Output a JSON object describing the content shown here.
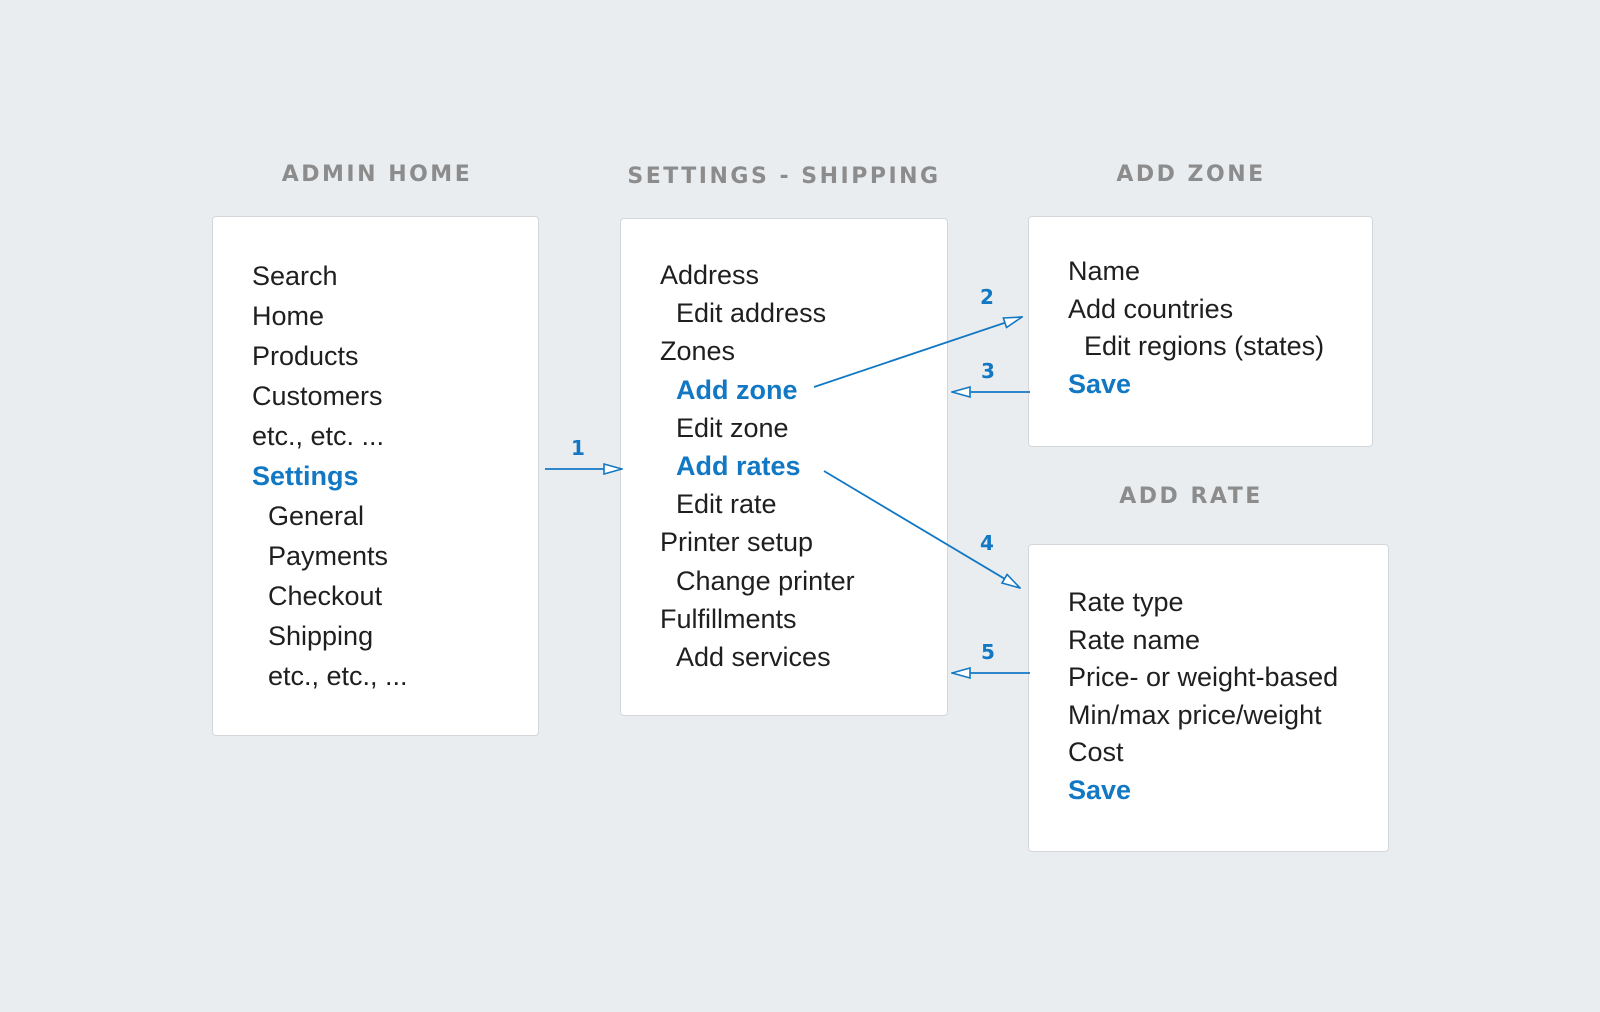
{
  "colors": {
    "background": "#eaedf0",
    "panel": "#ffffff",
    "title": "#8c8c8c",
    "text": "#1f1f1f",
    "accent": "#1278c4"
  },
  "panels": {
    "admin_home": {
      "title": "ADMIN HOME",
      "items": [
        {
          "label": "Search",
          "level": 0
        },
        {
          "label": "Home",
          "level": 0
        },
        {
          "label": "Products",
          "level": 0
        },
        {
          "label": "Customers",
          "level": 0
        },
        {
          "label": "etc., etc. ...",
          "level": 0
        },
        {
          "label": "Settings",
          "level": 0,
          "highlight": true
        },
        {
          "label": "General",
          "level": 1
        },
        {
          "label": "Payments",
          "level": 1
        },
        {
          "label": "Checkout",
          "level": 1
        },
        {
          "label": "Shipping",
          "level": 1
        },
        {
          "label": "etc., etc., ...",
          "level": 1
        }
      ]
    },
    "settings_shipping": {
      "title": "SETTINGS - SHIPPING",
      "items": [
        {
          "label": "Address",
          "level": 0
        },
        {
          "label": "Edit address",
          "level": 1
        },
        {
          "label": "Zones",
          "level": 0
        },
        {
          "label": "Add zone",
          "level": 1,
          "highlight": true
        },
        {
          "label": "Edit zone",
          "level": 1
        },
        {
          "label": "Add rates",
          "level": 1,
          "highlight": true
        },
        {
          "label": "Edit rate",
          "level": 1
        },
        {
          "label": "Printer setup",
          "level": 0
        },
        {
          "label": "Change printer",
          "level": 1
        },
        {
          "label": "Fulfillments",
          "level": 0
        },
        {
          "label": "Add services",
          "level": 1
        }
      ]
    },
    "add_zone": {
      "title": "ADD ZONE",
      "items": [
        {
          "label": "Name",
          "level": 0
        },
        {
          "label": "Add countries",
          "level": 0
        },
        {
          "label": "Edit regions (states)",
          "level": 1
        },
        {
          "label": "Save",
          "level": 0,
          "highlight": true
        }
      ]
    },
    "add_rate": {
      "title": "ADD RATE",
      "items": [
        {
          "label": "Rate type",
          "level": 0
        },
        {
          "label": "Rate name",
          "level": 0
        },
        {
          "label": "Price- or weight-based",
          "level": 0
        },
        {
          "label": "Min/max price/weight",
          "level": 0
        },
        {
          "label": "Cost",
          "level": 0
        },
        {
          "label": "Save",
          "level": 0,
          "highlight": true
        }
      ]
    }
  },
  "connectors": [
    {
      "step": "1",
      "from": "Settings",
      "to": "SETTINGS - SHIPPING"
    },
    {
      "step": "2",
      "from": "Add zone",
      "to": "ADD ZONE"
    },
    {
      "step": "3",
      "from": "ADD ZONE",
      "to": "SETTINGS - SHIPPING"
    },
    {
      "step": "4",
      "from": "Add rates",
      "to": "ADD RATE"
    },
    {
      "step": "5",
      "from": "ADD RATE",
      "to": "SETTINGS - SHIPPING"
    }
  ]
}
